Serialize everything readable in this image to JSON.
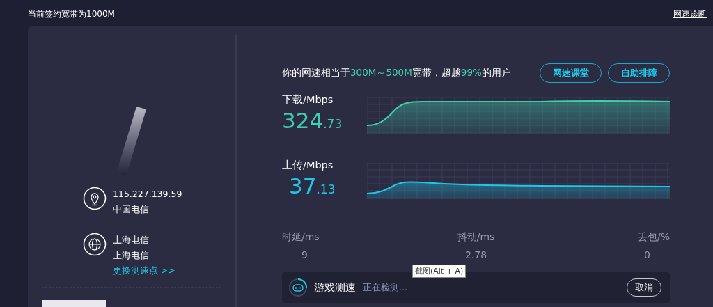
{
  "header": {
    "plan": "当前签约宽带为1000M",
    "report_link": "网速诊断"
  },
  "client": {
    "ip": "115.227.139.59",
    "isp": "中国电信",
    "server_name": "上海电信",
    "server_isp": "上海电信",
    "change_link": "更换测速点 >>"
  },
  "summary": [
    {
      "text": "你的网速相当于",
      "highlight": false
    },
    {
      "text": "300M～500M",
      "highlight": true
    },
    {
      "text": "宽带，超越",
      "highlight": false
    },
    {
      "text": "99%",
      "highlight": true
    },
    {
      "text": "的用户",
      "highlight": false
    }
  ],
  "buttons": [
    "网速课堂",
    "自助排障"
  ],
  "speeds": [
    {
      "kind": "download",
      "label": "下载/Mbps",
      "integer": "324",
      "decimal": ".73"
    },
    {
      "kind": "upload",
      "label": "上传/Mbps",
      "integer": "37",
      "decimal": ".13"
    }
  ],
  "stats": [
    {
      "label": "时延/ms",
      "value": "9"
    },
    {
      "label": "抖动/ms",
      "value": "2.78"
    },
    {
      "label": "丢包/%",
      "value": "0"
    }
  ],
  "game_test": {
    "title": "游戏测速",
    "status": "正在检测...",
    "cancel": "取消"
  },
  "tooltip": "截图(Alt + A)"
}
